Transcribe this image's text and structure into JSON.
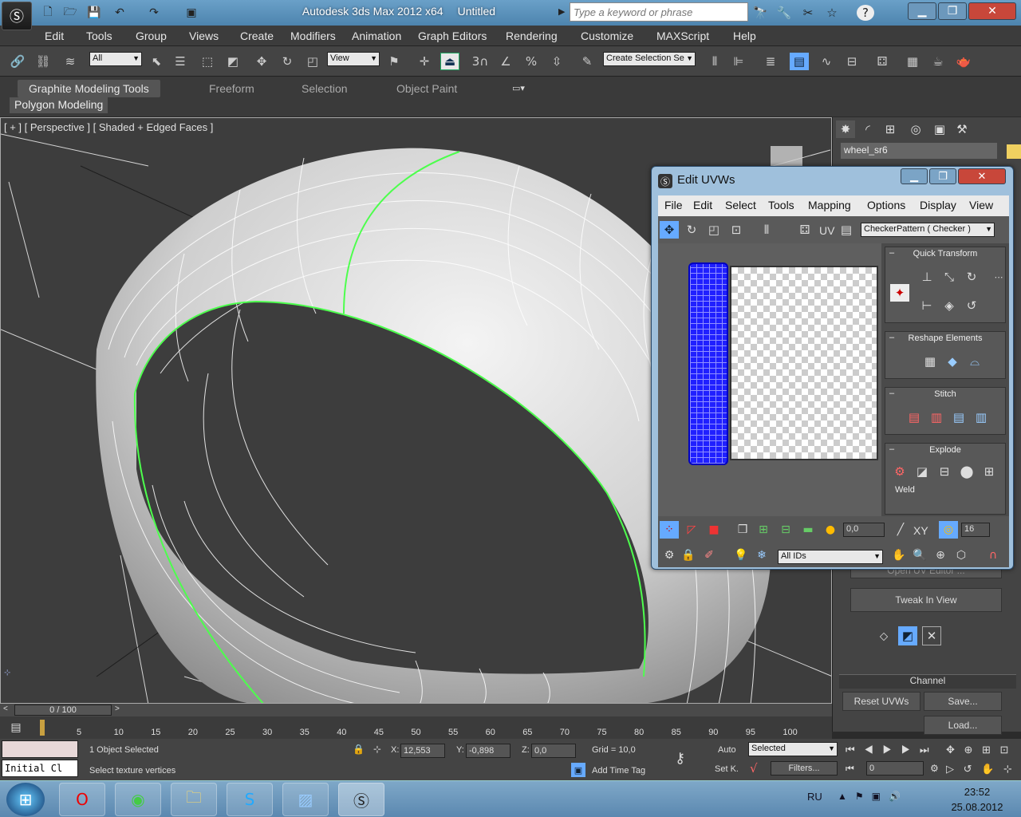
{
  "title": {
    "app": "Autodesk 3ds Max  2012 x64",
    "doc": "Untitled"
  },
  "search": {
    "placeholder": "Type a keyword or phrase"
  },
  "menu": [
    "Edit",
    "Tools",
    "Group",
    "Views",
    "Create",
    "Modifiers",
    "Animation",
    "Graph Editors",
    "Rendering",
    "Customize",
    "MAXScript",
    "Help"
  ],
  "toolbar": {
    "filter": "All",
    "ref_coord": "View",
    "num_3": "3",
    "selection_set": "Create Selection Se"
  },
  "ribbon": {
    "tabs": [
      "Graphite Modeling Tools",
      "Freeform",
      "Selection",
      "Object Paint"
    ],
    "panel": "Polygon Modeling"
  },
  "viewport": {
    "label": "[ + ] [ Perspective ] [ Shaded + Edged Faces ]"
  },
  "command_panel": {
    "object_name": "wheel_sr6",
    "tweak": "Tweak In View",
    "channel": "Channel",
    "reset": "Reset UVWs",
    "save": "Save...",
    "load": "Load...",
    "clipped": "Open UV Editor ..."
  },
  "uvw": {
    "title": "Edit UVWs",
    "menu": [
      "File",
      "Edit",
      "Select",
      "Tools",
      "Mapping",
      "Options",
      "Display",
      "View"
    ],
    "uv_label": "UV",
    "map": "CheckerPattern  ( Checker )",
    "sections": {
      "quick": "Quick Transform",
      "reshape": "Reshape Elements",
      "stitch": "Stitch",
      "explode": "Explode",
      "weld": "Weld"
    },
    "bottom": {
      "value": "0,0",
      "xy": "XY",
      "grid": "16",
      "ids": "All IDs"
    }
  },
  "time": {
    "slider": "0 / 100",
    "ticks": [
      "5",
      "10",
      "15",
      "20",
      "25",
      "30",
      "35",
      "40",
      "45",
      "50",
      "55",
      "60",
      "65",
      "70",
      "75",
      "80",
      "85",
      "90",
      "95",
      "100"
    ]
  },
  "status": {
    "initial": "Initial Cl",
    "selected": "1 Object Selected",
    "prompt": "Select texture vertices",
    "x": "12,553",
    "y": "-0,898",
    "z": "0,0",
    "grid": "Grid = 10,0",
    "auto": "Auto",
    "set_key": "Set K.",
    "key_mode": "Selected",
    "filters": "Filters...",
    "add_tag": "Add Time Tag",
    "frame": "0",
    "x_lbl": "X:",
    "y_lbl": "Y:",
    "z_lbl": "Z:"
  },
  "taskbar": {
    "lang": "RU",
    "time": "23:52",
    "date": "25.08.2012"
  }
}
